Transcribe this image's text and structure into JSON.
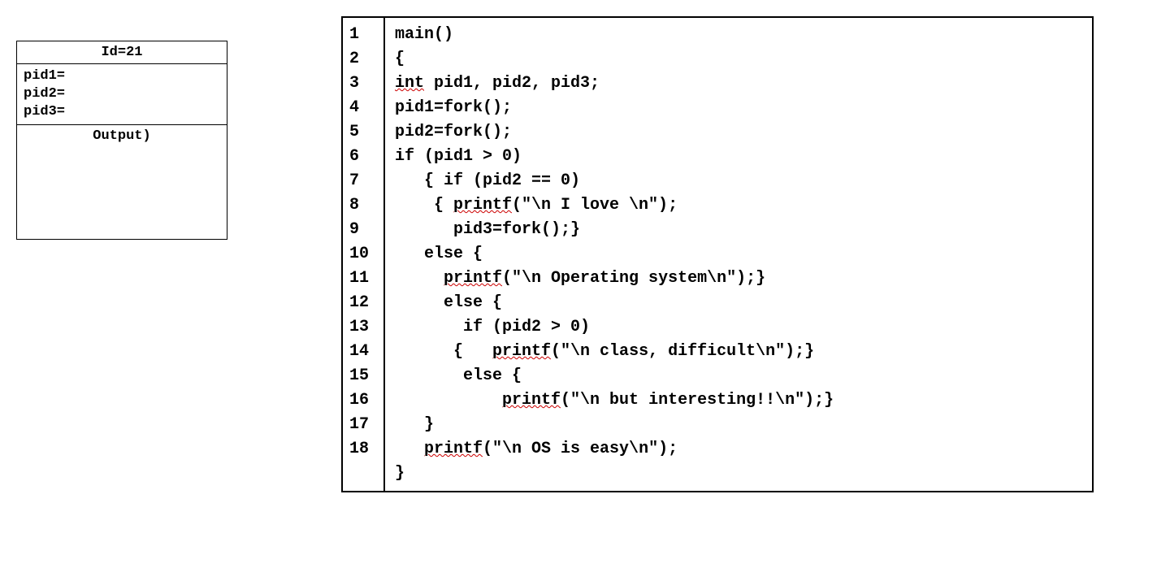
{
  "process_box": {
    "header": "Id=21",
    "pid1_label": "pid1=",
    "pid2_label": "pid2=",
    "pid3_label": "pid3=",
    "output_label": "Output)"
  },
  "code": {
    "line_numbers": [
      "1",
      "2",
      "3",
      "4",
      "5",
      "6",
      "7",
      "8",
      "9",
      "10",
      "11",
      "12",
      "13",
      "14",
      "15",
      "16",
      "17",
      "18",
      ""
    ],
    "lines": {
      "l1": "main()",
      "l2": "{",
      "l3a": "int",
      "l3b": " pid1, pid2, pid3;",
      "l4": "pid1=fork();",
      "l5": "pid2=fork();",
      "l6": "if (pid1 > 0)",
      "l7": "   { if (pid2 == 0)",
      "l8a": "    { ",
      "l8b": "printf",
      "l8c": "(\"\\n I love \\n\");",
      "l9": "      pid3=fork();}",
      "l10": "   else {",
      "l11a": "     ",
      "l11b": "printf",
      "l11c": "(\"\\n Operating system\\n\");}",
      "l12": "     else {",
      "l13": "       if (pid2 > 0)",
      "l14a": "      {   ",
      "l14b": "printf",
      "l14c": "(\"\\n class, difficult\\n\");}",
      "l15": "       else {",
      "l16a": "           ",
      "l16b": "printf",
      "l16c": "(\"\\n but interesting!!\\n\");}",
      "l17": "   }",
      "l18a": "   ",
      "l18b": "printf",
      "l18c": "(\"\\n OS is easy\\n\");",
      "l19": "}"
    }
  }
}
